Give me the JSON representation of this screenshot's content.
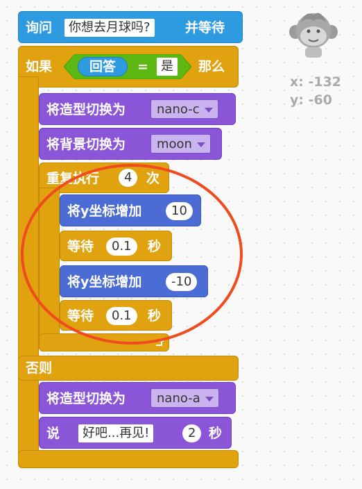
{
  "ask_block": {
    "label": "询问",
    "text": "你想去月球吗?",
    "suffix": "并等待"
  },
  "if_block": {
    "label": "如果",
    "reporter": "回答",
    "operator": "=",
    "value": "是",
    "then": "那么",
    "else": "否则"
  },
  "switch_costume_1": {
    "label": "将造型切换为",
    "value": "nano-c"
  },
  "switch_backdrop": {
    "label": "将背景切换为",
    "value": "moon"
  },
  "repeat_block": {
    "label": "重复执行",
    "count": "4",
    "suffix": "次"
  },
  "change_y_1": {
    "label": "将y坐标增加",
    "value": "10"
  },
  "wait_1": {
    "label": "等待",
    "value": "0.1",
    "suffix": "秒"
  },
  "change_y_2": {
    "label": "将y坐标增加",
    "value": "-10"
  },
  "wait_2": {
    "label": "等待",
    "value": "0.1",
    "suffix": "秒"
  },
  "switch_costume_2": {
    "label": "将造型切换为",
    "value": "nano-a"
  },
  "say_block": {
    "label": "说",
    "text": "好吧...再见!",
    "secs": "2",
    "suffix": "秒"
  },
  "sprite_info": {
    "x": "x: -132",
    "y": "y: -60",
    "icon": "monkey-sprite-icon"
  },
  "colors": {
    "sensing": "#2e9be0",
    "control": "#e0a20e",
    "looks": "#8a55d7",
    "motion": "#4a6cd4",
    "annotation": "#f04a1f"
  }
}
